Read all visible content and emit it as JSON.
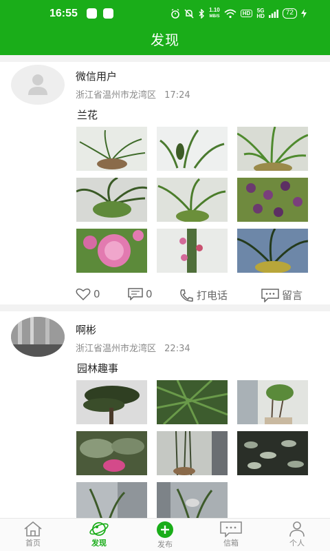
{
  "status_bar": {
    "time": "16:55",
    "net_speed_top": "1.10",
    "net_speed_bottom": "MB/S",
    "hd": "HD",
    "signal_label_top": "5G",
    "signal_label_bottom": "HD",
    "battery": "72"
  },
  "header": {
    "title": "发现"
  },
  "posts": [
    {
      "username": "微信用户",
      "location": "浙江省温州市龙湾区",
      "time": "17:24",
      "text": "兰花",
      "likes": "0",
      "comments": "0",
      "call_label": "打电话",
      "message_label": "留言"
    },
    {
      "username": "啊彬",
      "location": "浙江省温州市龙湾区",
      "time": "22:34",
      "text": "园林趣事"
    }
  ],
  "tabbar": {
    "items": [
      {
        "label": "首页",
        "icon": "home-icon"
      },
      {
        "label": "发现",
        "icon": "planet-icon"
      },
      {
        "label": "发布",
        "icon": "plus-circle-icon"
      },
      {
        "label": "信箱",
        "icon": "message-icon"
      },
      {
        "label": "个人",
        "icon": "person-icon"
      }
    ],
    "active": "发现"
  },
  "colors": {
    "brand_green": "#1aad19",
    "divider": "#f2f2f2"
  }
}
